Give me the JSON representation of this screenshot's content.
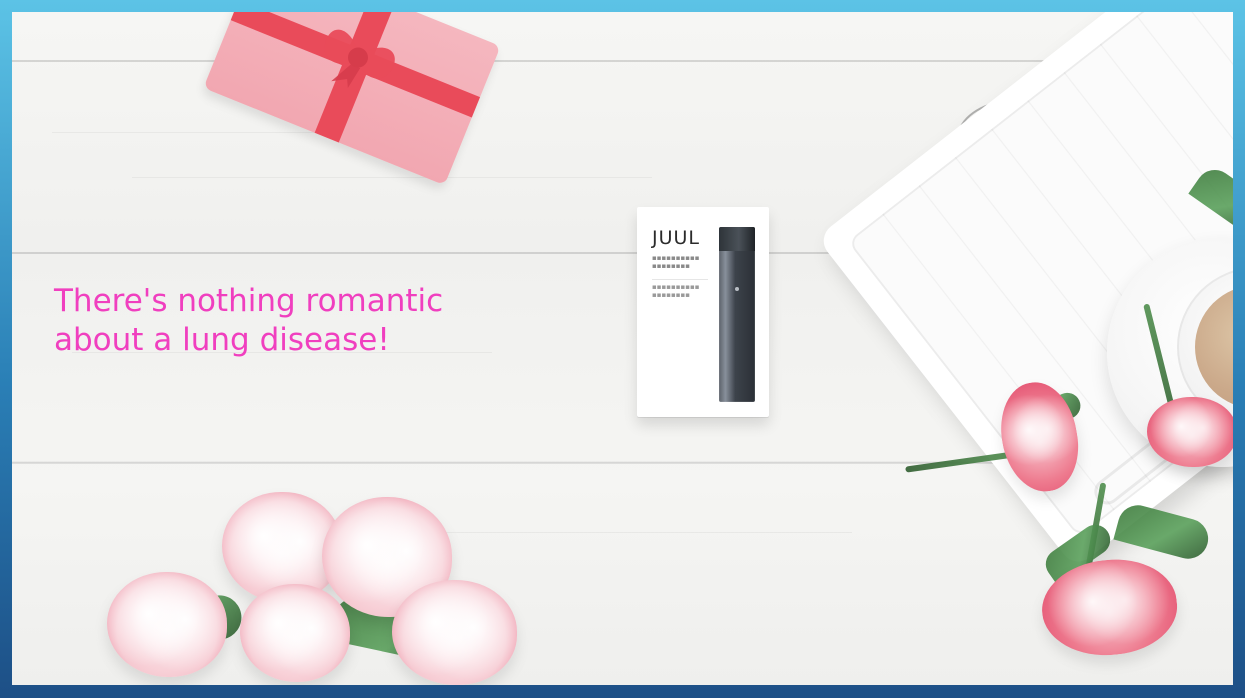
{
  "slide": {
    "headline": "There's nothing romantic\nabout a lung disease!",
    "product": {
      "brand": "JUUL"
    }
  }
}
